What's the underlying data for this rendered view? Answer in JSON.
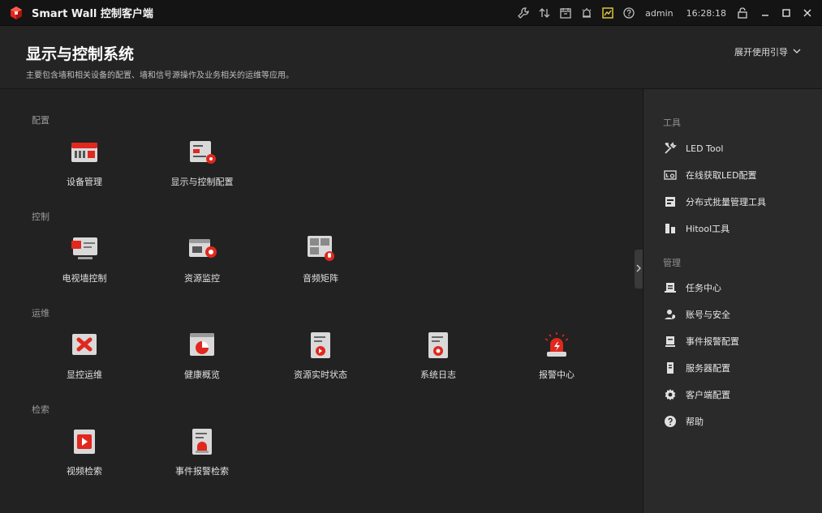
{
  "app": {
    "title": "Smart Wall 控制客户端",
    "user": "admin",
    "time": "16:28:18",
    "accent": "#e0281e"
  },
  "header": {
    "title": "显示与控制系统",
    "subtitle": "主要包含墙和相关设备的配置、墙和信号源操作及业务相关的运维等应用。",
    "guide_label": "展开使用引导"
  },
  "sections": {
    "config": "配置",
    "control": "控制",
    "ops": "运维",
    "search": "检索"
  },
  "tiles": {
    "device_mgmt": "设备管理",
    "display_control_config": "显示与控制配置",
    "tv_wall_control": "电视墙控制",
    "resource_monitor": "资源监控",
    "audio_matrix": "音频矩阵",
    "display_ops": "显控运维",
    "health_overview": "健康概览",
    "resource_realtime_status": "资源实时状态",
    "system_log": "系统日志",
    "alarm_center": "报警中心",
    "video_search": "视频检索",
    "event_alarm_search": "事件报警检索"
  },
  "right_panel": {
    "tools_label": "工具",
    "manage_label": "管理",
    "tools": [
      "LED Tool",
      "在线获取LED配置",
      "分布式批量管理工具",
      "Hitool工具"
    ],
    "manage": [
      "任务中心",
      "账号与安全",
      "事件报警配置",
      "服务器配置",
      "客户端配置",
      "帮助"
    ]
  },
  "icons": {
    "titlebar": [
      "wrench-icon",
      "transfer-icon",
      "calendar-icon",
      "alarm-bell-icon",
      "chart-icon",
      "help-icon"
    ],
    "window": [
      "lock-icon",
      "minimize-icon",
      "maximize-icon",
      "close-icon"
    ]
  }
}
